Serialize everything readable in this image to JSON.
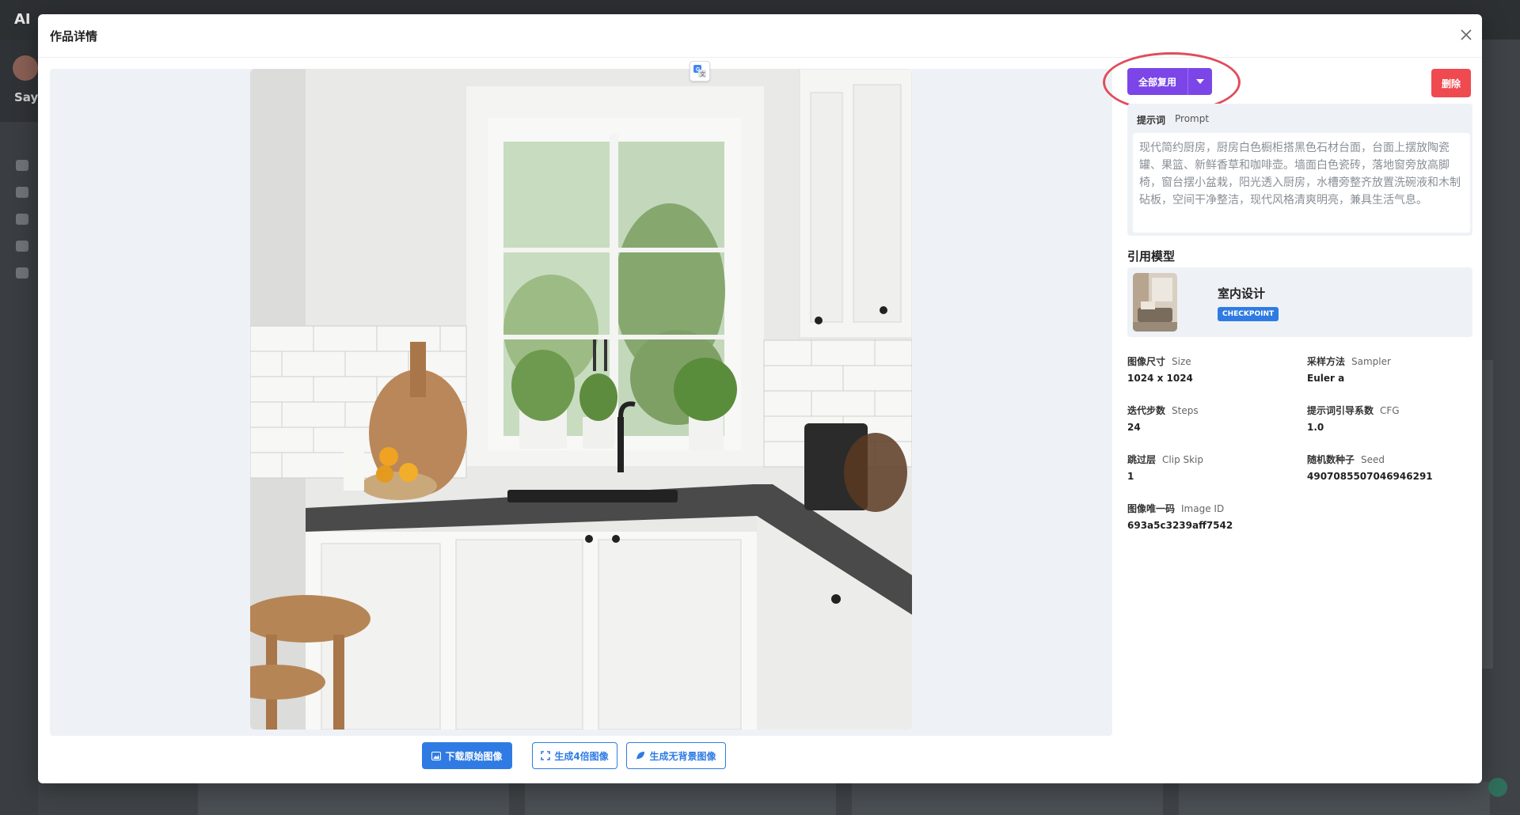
{
  "background": {
    "brand": "AI",
    "user_name": "Say"
  },
  "modal": {
    "title": "作品详情",
    "close_icon": "close-icon",
    "translate_icon": "translate-icon",
    "actions": {
      "download_original": "下载原始图像",
      "upscale_4x": "生成4倍图像",
      "remove_background": "生成无背景图像"
    },
    "reuse_all": "全部复用",
    "delete": "删除",
    "prompt": {
      "label": "提示词",
      "label_en": "Prompt",
      "text": "现代简约厨房，厨房白色橱柜搭黑色石材台面，台面上摆放陶瓷罐、果篮、新鲜香草和咖啡壶。墙面白色瓷砖，落地窗旁放高脚椅，窗台摆小盆栽，阳光透入厨房，水槽旁整齐放置洗碗液和木制砧板，空间干净整洁，现代风格清爽明亮，兼具生活气息。"
    },
    "model": {
      "heading": "引用模型",
      "name": "室内设计",
      "badge": "CHECKPOINT"
    },
    "params": {
      "size": {
        "label": "图像尺寸",
        "label_en": "Size",
        "value": "1024 x 1024"
      },
      "sampler": {
        "label": "采样方法",
        "label_en": "Sampler",
        "value": "Euler a"
      },
      "steps": {
        "label": "迭代步数",
        "label_en": "Steps",
        "value": "24"
      },
      "cfg": {
        "label": "提示词引导系数",
        "label_en": "CFG",
        "value": "1.0"
      },
      "clip_skip": {
        "label": "跳过层",
        "label_en": "Clip Skip",
        "value": "1"
      },
      "seed": {
        "label": "随机数种子",
        "label_en": "Seed",
        "value": "4907085507046946291"
      },
      "image_id": {
        "label": "图像唯一码",
        "label_en": "Image ID",
        "value": "693a5c3239aff7542"
      }
    },
    "colors": {
      "accent_blue": "#2f7be3",
      "accent_purple": "#7c45e8",
      "danger_red": "#ef4a4f",
      "highlight_ring": "#e04d5b"
    }
  }
}
